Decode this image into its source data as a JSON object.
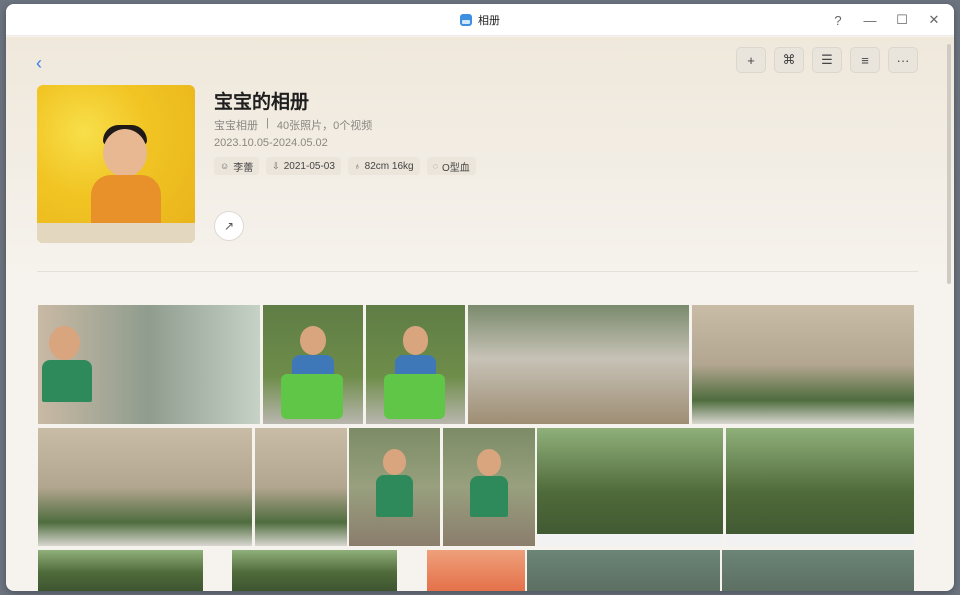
{
  "window": {
    "title": "相册",
    "controls": {
      "help": "?",
      "minimize": "—",
      "maximize": "☐",
      "close": "✕"
    }
  },
  "header": {
    "back_icon": "‹",
    "toolbar": [
      {
        "name": "add-button",
        "icon": "+"
      },
      {
        "name": "scan-button",
        "icon": "⌘"
      },
      {
        "name": "sort-button",
        "icon": "☰"
      },
      {
        "name": "list-view-button",
        "icon": "≡"
      },
      {
        "name": "more-button",
        "icon": "···"
      }
    ],
    "album": {
      "title": "宝宝的相册",
      "type": "宝宝相册",
      "separator": "|",
      "counts": "40张照片，0个视频",
      "date_range": "2023.10.05-2024.05.02",
      "tags": [
        {
          "icon": "☺",
          "label": "李蕾"
        },
        {
          "icon": "⇩",
          "label": "2021-05-03"
        },
        {
          "icon": "♁",
          "label": "82cm 16kg"
        },
        {
          "icon": "◌",
          "label": "O型血"
        }
      ],
      "share_icon": "↗"
    }
  },
  "grid_colors": {
    "aquarium": "#7d8c84",
    "grass": "#6e8d4a",
    "zoo": "#a49b86",
    "temple": "#b8ab96",
    "forest": "#4f6a3a",
    "forest_light": "#7e9a5c",
    "coral": "#e4714a",
    "cliff": "#5c6f62"
  }
}
